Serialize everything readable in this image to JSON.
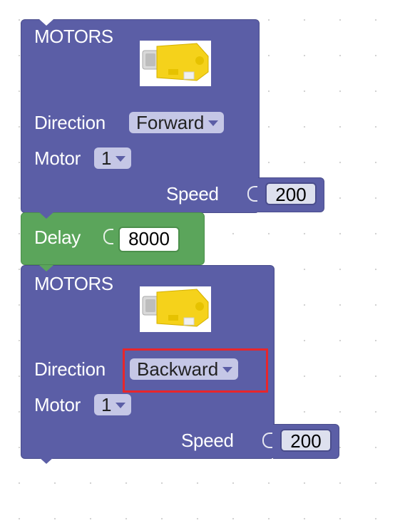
{
  "blocks": [
    {
      "title": "MOTORS",
      "direction_label": "Direction",
      "direction_value": "Forward",
      "motor_label": "Motor",
      "motor_value": "1",
      "speed_label": "Speed",
      "speed_value": "200"
    },
    {
      "delay_label": "Delay",
      "delay_value": "8000"
    },
    {
      "title": "MOTORS",
      "direction_label": "Direction",
      "direction_value": "Backward",
      "motor_label": "Motor",
      "motor_value": "1",
      "speed_label": "Speed",
      "speed_value": "200"
    }
  ],
  "colors": {
    "motor_block": "#5b5ea6",
    "delay_block": "#5ba55b",
    "dropdown_bg": "#c5c7e6",
    "highlight": "#e8262b"
  },
  "icons": {
    "motor_image": "yellow-dc-gear-motor-icon",
    "dropdown": "chevron-down-icon"
  }
}
